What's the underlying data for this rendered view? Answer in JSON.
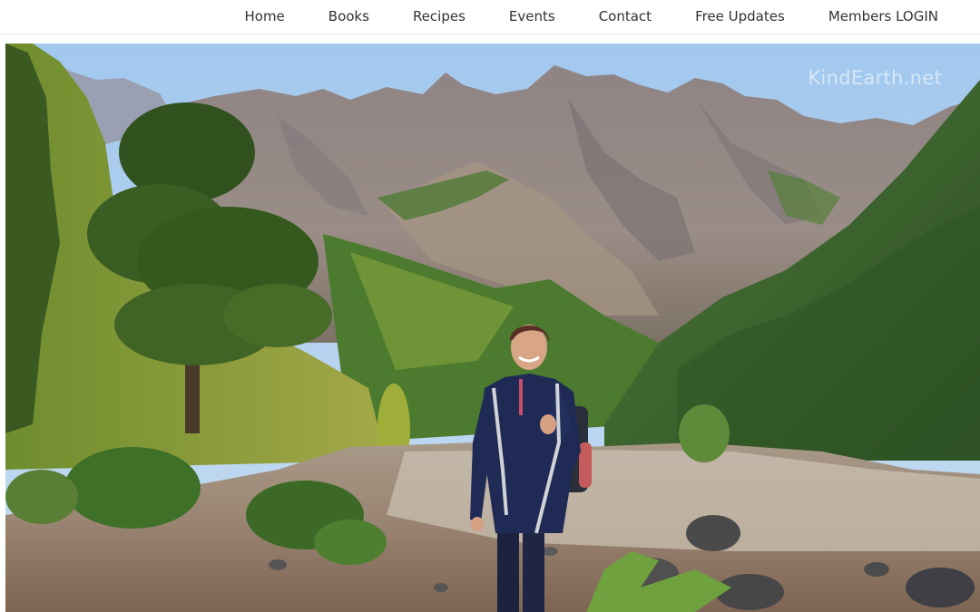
{
  "nav": {
    "items": [
      {
        "label": "Home"
      },
      {
        "label": "Books"
      },
      {
        "label": "Recipes"
      },
      {
        "label": "Events"
      },
      {
        "label": "Contact"
      },
      {
        "label": "Free Updates"
      },
      {
        "label": "Members LOGIN"
      }
    ]
  },
  "hero": {
    "watermark": "KindEarth.net"
  },
  "colors": {
    "sky": "#a9cdef",
    "mountain": "#8a7f80",
    "forest": "#3f6b2c",
    "ground": "#8b6e57",
    "nav_text": "#333333"
  }
}
